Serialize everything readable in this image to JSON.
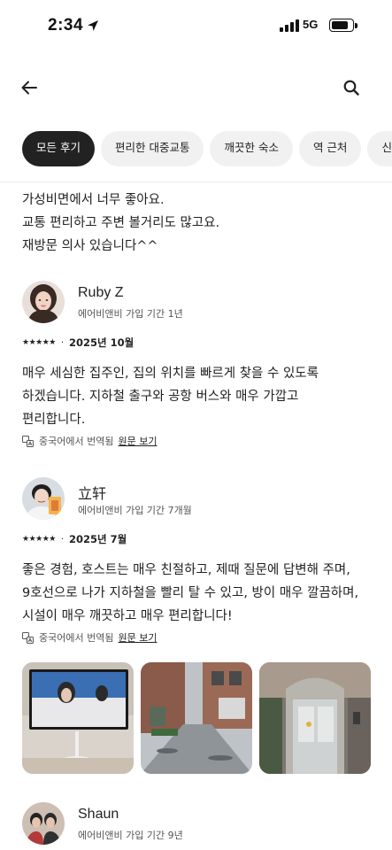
{
  "status_bar": {
    "time": "2:34",
    "network": "5G"
  },
  "filters": [
    {
      "label": "모든 후기",
      "active": true
    },
    {
      "label": "편리한 대중교통",
      "active": false
    },
    {
      "label": "깨끗한 숙소",
      "active": false
    },
    {
      "label": "역 근처",
      "active": false
    },
    {
      "label": "신속",
      "active": false
    }
  ],
  "intro_review": {
    "lines": [
      "가성비면에서 너무 좋아요.",
      "교통 편리하고 주변 볼거리도 많고요.",
      "재방문 의사 있습니다^^"
    ]
  },
  "reviews": [
    {
      "name": "Ruby Z",
      "meta": "에어비앤비 가입 기간 1년",
      "stars": "★★★★★",
      "separator": "·",
      "date": "2025년 10월",
      "body_lines": [
        "매우 세심한 집주인, 집의 위치를 빠르게 찾을 수 있도록",
        "하겠습니다. 지하철 출구와 공항 버스와 매우 가깝고",
        "편리합니다."
      ],
      "translation_note": "중국어에서 번역됨",
      "original_link": "원문 보기"
    },
    {
      "name": "立轩",
      "meta": "에어비앤비 가입 기간 7개월",
      "stars": "★★★★★",
      "separator": "·",
      "date": "2025년 7월",
      "body_lines": [
        "좋은 경험, 호스트는 매우 친절하고, 제때 질문에 답변해 주며,",
        "9호선으로 나가 지하철을 빨리 탈 수 있고, 방이 매우 깔끔하며,",
        "시설이 매우 깨끗하고 매우 편리합니다!"
      ],
      "translation_note": "중국어에서 번역됨",
      "original_link": "원문 보기"
    },
    {
      "name": "Shaun",
      "meta": "에어비앤비 가입 기간 9년"
    }
  ],
  "colors": {
    "active_chip": "#222222",
    "chip": "#f1f1f1",
    "text": "#222222"
  }
}
